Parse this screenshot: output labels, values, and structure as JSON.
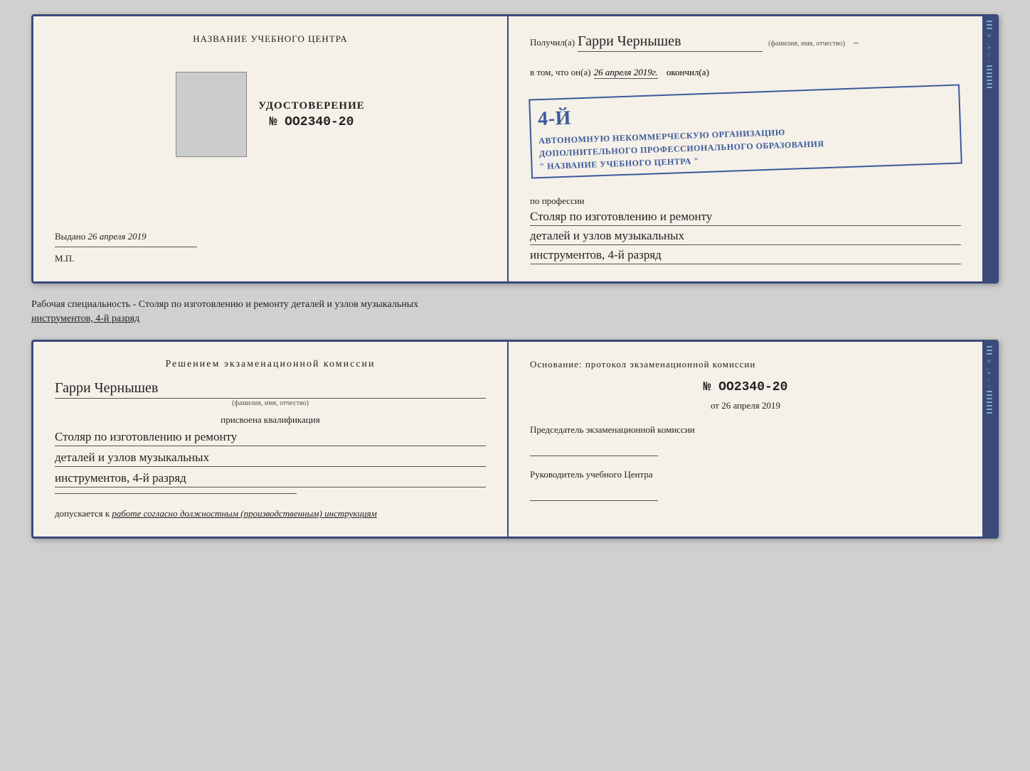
{
  "top_cert": {
    "left": {
      "center_title": "НАЗВАНИЕ УЧЕБНОГО ЦЕНТРА",
      "cert_label": "УДОСТОВЕРЕНИЕ",
      "cert_number": "№ OO2340-20",
      "issued_label": "Выдано",
      "issued_date": "26 апреля 2019",
      "mp_label": "М.П."
    },
    "right": {
      "recipient_prefix": "Получил(а)",
      "recipient_name": "Гарри Чернышев",
      "recipient_hint": "(фамилия, имя, отчество)",
      "tom_line_prefix": "в том, что он(а)",
      "tom_date": "26 апреля 2019г.",
      "okончил_label": "окончил(а)",
      "stamp_line1": "4-й",
      "stamp_org1": "АВТОНОМНУЮ НЕКОММЕРЧЕСКУЮ ОРГАНИЗАЦИЮ",
      "stamp_org2": "ДОПОЛНИТЕЛЬНОГО ПРОФЕССИОНАЛЬНОГО ОБРАЗОВАНИЯ",
      "stamp_org3": "\" НАЗВАНИЕ УЧЕБНОГО ЦЕНТРА \"",
      "profession_label": "по профессии",
      "profession_line1": "Столяр по изготовлению и ремонту",
      "profession_line2": "деталей и узлов музыкальных",
      "profession_line3": "инструментов, 4-й разряд"
    }
  },
  "caption": {
    "text": "Рабочая специальность - Столяр по изготовлению и ремонту деталей и узлов музыкальных",
    "text2": "инструментов, 4-й разряд"
  },
  "bottom_cert": {
    "left": {
      "decision_title": "Решением  экзаменационной  комиссии",
      "name": "Гарри Чернышев",
      "name_hint": "(фамилия, имя, отчество)",
      "assigned_label": "присвоена квалификация",
      "qual_line1": "Столяр по изготовлению и ремонту",
      "qual_line2": "деталей и узлов музыкальных",
      "qual_line3": "инструментов, 4-й разряд",
      "допускается_label": "допускается к",
      "допускается_value": "работе согласно должностным (производственным) инструкциям"
    },
    "right": {
      "basis_label": "Основание: протокол  экзаменационной  комиссии",
      "protocol_number": "№  OO2340-20",
      "from_label": "от",
      "from_date": "26 апреля 2019",
      "chairman_label": "Председатель экзаменационной комиссии",
      "director_label": "Руководитель учебного Центра"
    }
  }
}
